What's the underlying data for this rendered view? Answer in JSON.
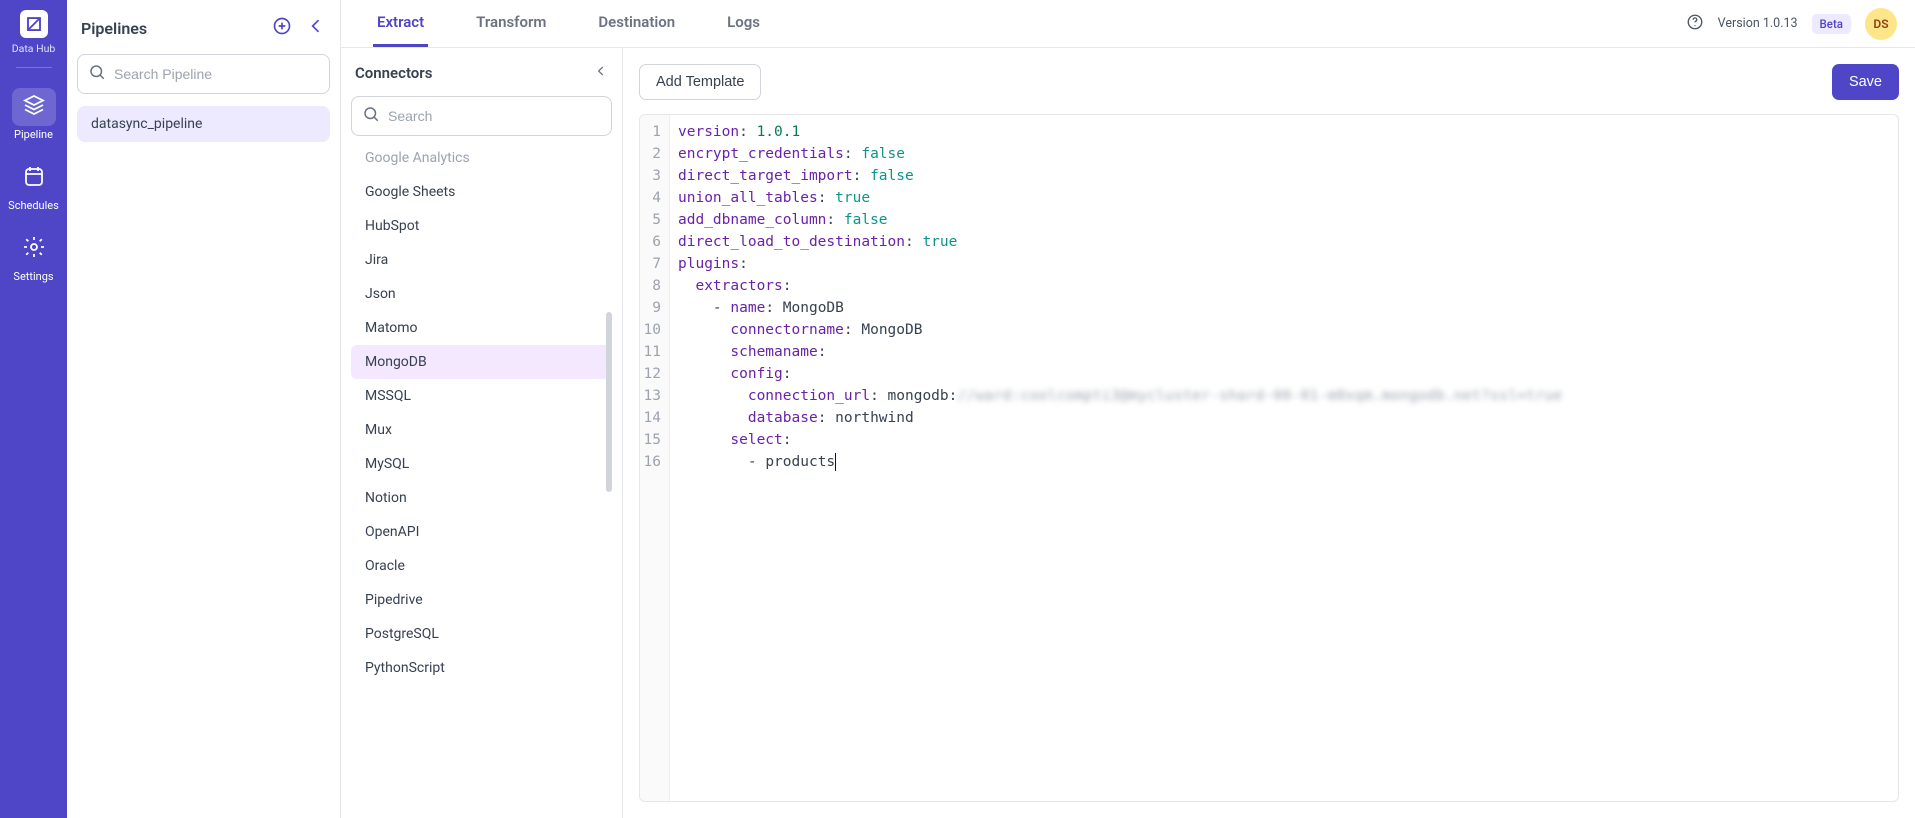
{
  "app": {
    "name": "Data Hub"
  },
  "rail": {
    "items": [
      {
        "id": "pipeline",
        "label": "Pipeline",
        "active": true
      },
      {
        "id": "schedules",
        "label": "Schedules",
        "active": false
      },
      {
        "id": "settings",
        "label": "Settings",
        "active": false
      }
    ]
  },
  "pipelines_panel": {
    "title": "Pipelines",
    "search_placeholder": "Search Pipeline",
    "items": [
      {
        "name": "datasync_pipeline",
        "active": true
      }
    ]
  },
  "tabs": [
    {
      "id": "extract",
      "label": "Extract",
      "active": true
    },
    {
      "id": "transform",
      "label": "Transform",
      "active": false
    },
    {
      "id": "destination",
      "label": "Destination",
      "active": false
    },
    {
      "id": "logs",
      "label": "Logs",
      "active": false
    }
  ],
  "header_right": {
    "version_label": "Version 1.0.13",
    "beta_label": "Beta",
    "avatar_initials": "DS"
  },
  "connectors_panel": {
    "title": "Connectors",
    "search_placeholder": "Search",
    "selected": "MongoDB",
    "visible_items": [
      "Google Analytics",
      "Google Sheets",
      "HubSpot",
      "Jira",
      "Json",
      "Matomo",
      "MongoDB",
      "MSSQL",
      "Mux",
      "MySQL",
      "Notion",
      "OpenAPI",
      "Oracle",
      "Pipedrive",
      "PostgreSQL",
      "PythonScript"
    ]
  },
  "editor_toolbar": {
    "add_template_label": "Add Template",
    "save_label": "Save"
  },
  "editor": {
    "line_count": 16,
    "lines": [
      {
        "n": 1,
        "tokens": [
          {
            "t": "k",
            "v": "version"
          },
          {
            "t": "p",
            "v": ": "
          },
          {
            "t": "num",
            "v": "1.0.1"
          }
        ]
      },
      {
        "n": 2,
        "tokens": [
          {
            "t": "k",
            "v": "encrypt_credentials"
          },
          {
            "t": "p",
            "v": ": "
          },
          {
            "t": "bool",
            "v": "false"
          }
        ]
      },
      {
        "n": 3,
        "tokens": [
          {
            "t": "k",
            "v": "direct_target_import"
          },
          {
            "t": "p",
            "v": ": "
          },
          {
            "t": "bool",
            "v": "false"
          }
        ]
      },
      {
        "n": 4,
        "tokens": [
          {
            "t": "k",
            "v": "union_all_tables"
          },
          {
            "t": "p",
            "v": ": "
          },
          {
            "t": "bool",
            "v": "true"
          }
        ]
      },
      {
        "n": 5,
        "tokens": [
          {
            "t": "k",
            "v": "add_dbname_column"
          },
          {
            "t": "p",
            "v": ": "
          },
          {
            "t": "bool",
            "v": "false"
          }
        ]
      },
      {
        "n": 6,
        "tokens": [
          {
            "t": "k",
            "v": "direct_load_to_destination"
          },
          {
            "t": "p",
            "v": ": "
          },
          {
            "t": "bool",
            "v": "true"
          }
        ]
      },
      {
        "n": 7,
        "tokens": [
          {
            "t": "k",
            "v": "plugins"
          },
          {
            "t": "p",
            "v": ":"
          }
        ]
      },
      {
        "n": 8,
        "tokens": [
          {
            "t": "ws",
            "v": "  "
          },
          {
            "t": "k",
            "v": "extractors"
          },
          {
            "t": "p",
            "v": ":"
          }
        ]
      },
      {
        "n": 9,
        "tokens": [
          {
            "t": "ws",
            "v": "    "
          },
          {
            "t": "dash",
            "v": "- "
          },
          {
            "t": "k",
            "v": "name"
          },
          {
            "t": "p",
            "v": ": "
          },
          {
            "t": "str",
            "v": "MongoDB"
          }
        ]
      },
      {
        "n": 10,
        "tokens": [
          {
            "t": "ws",
            "v": "      "
          },
          {
            "t": "k",
            "v": "connectorname"
          },
          {
            "t": "p",
            "v": ": "
          },
          {
            "t": "str",
            "v": "MongoDB"
          }
        ]
      },
      {
        "n": 11,
        "tokens": [
          {
            "t": "ws",
            "v": "      "
          },
          {
            "t": "k",
            "v": "schemaname"
          },
          {
            "t": "p",
            "v": ":"
          }
        ]
      },
      {
        "n": 12,
        "tokens": [
          {
            "t": "ws",
            "v": "      "
          },
          {
            "t": "k",
            "v": "config"
          },
          {
            "t": "p",
            "v": ":"
          }
        ]
      },
      {
        "n": 13,
        "tokens": [
          {
            "t": "ws",
            "v": "        "
          },
          {
            "t": "k",
            "v": "connection_url"
          },
          {
            "t": "p",
            "v": ": "
          },
          {
            "t": "str",
            "v": "mongodb:"
          },
          {
            "t": "blur",
            "v": "//ward:coolcompti3@mycluster-shard-00-01-m0xqm.mongodb.net?ssl=true"
          }
        ]
      },
      {
        "n": 14,
        "tokens": [
          {
            "t": "ws",
            "v": "        "
          },
          {
            "t": "k",
            "v": "database"
          },
          {
            "t": "p",
            "v": ": "
          },
          {
            "t": "str",
            "v": "northwind"
          }
        ]
      },
      {
        "n": 15,
        "tokens": [
          {
            "t": "ws",
            "v": "      "
          },
          {
            "t": "k",
            "v": "select"
          },
          {
            "t": "p",
            "v": ":"
          }
        ]
      },
      {
        "n": 16,
        "tokens": [
          {
            "t": "ws",
            "v": "        "
          },
          {
            "t": "dash",
            "v": "- "
          },
          {
            "t": "str",
            "v": "products"
          }
        ],
        "cursor_after": true
      }
    ]
  }
}
